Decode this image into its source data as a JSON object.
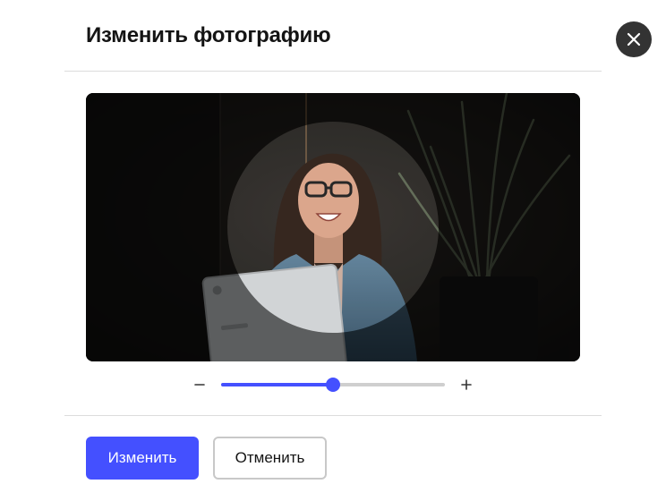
{
  "dialog": {
    "title": "Изменить фотографию"
  },
  "zoom": {
    "level": 0.5,
    "accent_color": "#4450ff"
  },
  "actions": {
    "apply_label": "Изменить",
    "cancel_label": "Отменить"
  },
  "icons": {
    "close": "close-icon",
    "zoom_out": "minus-icon",
    "zoom_in": "plus-icon"
  }
}
